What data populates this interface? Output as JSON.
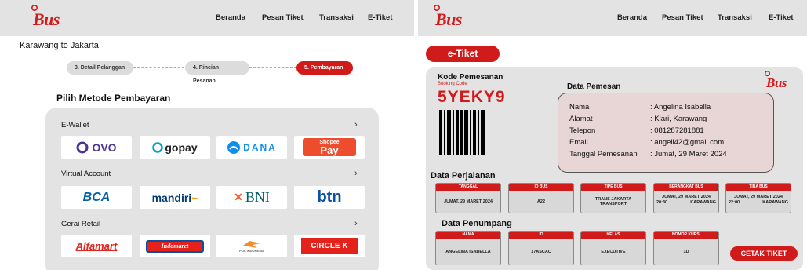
{
  "left": {
    "brand": "Bus",
    "nav": [
      "Beranda",
      "Pesan Tiket",
      "Transaksi",
      "E-Tiket"
    ],
    "route": "Karawang to Jakarta",
    "steps": [
      "3. Detail Pelanggan",
      "4. Rincian Pesanan",
      "5. Pembayaran"
    ],
    "payment_title": "Pilih Metode Pembayaran",
    "groups": [
      {
        "label": "E-Wallet",
        "items": [
          "OVO",
          "gopay",
          "DANA",
          "Shopee Pay"
        ]
      },
      {
        "label": "Virtual Account",
        "items": [
          "BCA",
          "mandiri",
          "BNI",
          "btn"
        ]
      },
      {
        "label": "Gerai Retail",
        "items": [
          "Alfamart",
          "Indomaret",
          "POS INDONESIA",
          "CIRCLE K"
        ]
      }
    ],
    "shopee_small": "Shopee",
    "shopee_big": "Pay"
  },
  "right": {
    "brand": "Bus",
    "nav": [
      "Beranda",
      "Pesan Tiket",
      "Transaksi",
      "E-Tiket"
    ],
    "etiket_label": "e-Tiket",
    "kode_title": "Kode Pemesanan",
    "booking_label": "Booking Code",
    "booking_code": "5YEKY9",
    "pemesan_title": "Data Pemesan",
    "pemesan": [
      {
        "k": "Nama",
        "v": ": Angelina Isabella"
      },
      {
        "k": "Alamat",
        "v": ": Klari, Karawang"
      },
      {
        "k": "Telepon",
        "v": ": 081287281881"
      },
      {
        "k": "Email",
        "v": ": angell42@gmail.com"
      },
      {
        "k": "Tanggal Pemesanan",
        "v": ": Jumat, 29 Maret 2024"
      }
    ],
    "perjalanan_title": "Data Perjalanan",
    "perjalanan": [
      {
        "h": "TANGGAL",
        "v": "JUMAT, 29 MARET 2024"
      },
      {
        "h": "ID BUS",
        "v": "A22"
      },
      {
        "h": "TIPE BUS",
        "v": "TRANS JAKARTA TRANSPORT"
      },
      {
        "h": "BERANGKAT BUS",
        "v": "JUMAT, 29 MARET 2024",
        "t": "20:30",
        "p": "KARAWANG"
      },
      {
        "h": "TIBA BUS",
        "v": "JUMAT, 29 MARET 2024",
        "t": "22:00",
        "p": "KARAWANG"
      }
    ],
    "penumpang_title": "Data Penumpang",
    "penumpang": [
      {
        "h": "NAMA",
        "v": "ANGELINA ISABELLA"
      },
      {
        "h": "ID",
        "v": "17ASCAC"
      },
      {
        "h": "KELAS",
        "v": "EXECUTIVE"
      },
      {
        "h": "NOMOR KURSI",
        "v": "1D"
      }
    ],
    "cetak_label": "CETAK TIKET"
  },
  "colors": {
    "accent": "#d11b1b",
    "panel": "#e3e3e3"
  }
}
